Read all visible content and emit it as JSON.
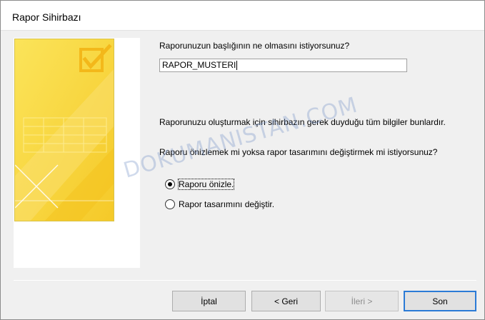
{
  "window": {
    "title": "Rapor Sihirbazı"
  },
  "form": {
    "question_title": "Raporunuzun başlığının ne olmasını istiyorsunuz?",
    "title_value": "RAPOR_MUSTERI",
    "info_text": "Raporunuzu oluşturmak için sihirbazın gerek duyduğu tüm bilgiler bunlardır.",
    "question_action": "Raporu önizlemek mi yoksa rapor tasarımını değiştirmek mi istiyorsunuz?",
    "options": [
      {
        "label": "Raporu önizle.",
        "checked": true
      },
      {
        "label": "Rapor tasarımını değiştir.",
        "checked": false
      }
    ]
  },
  "buttons": {
    "cancel": "İptal",
    "back": "< Geri",
    "next": "İleri >",
    "finish": "Son"
  },
  "watermark": "DOKUMANISTAN.COM",
  "colors": {
    "art_yellow": "#f7d436",
    "default_button_border": "#2b7bd6"
  }
}
